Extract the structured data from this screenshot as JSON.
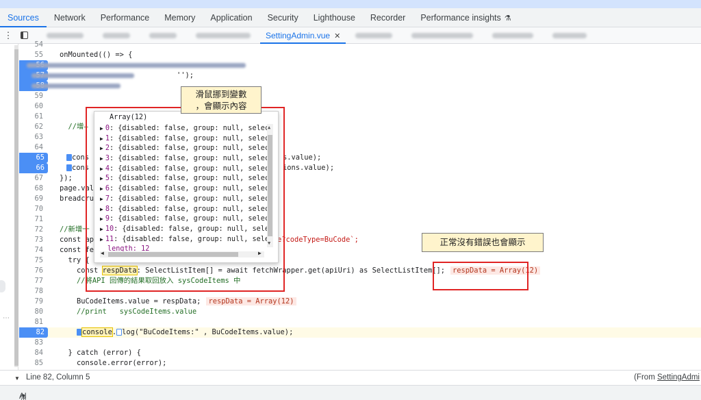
{
  "panel_tabs": [
    {
      "label": "Sources",
      "active": true
    },
    {
      "label": "Network"
    },
    {
      "label": "Performance"
    },
    {
      "label": "Memory"
    },
    {
      "label": "Application"
    },
    {
      "label": "Security"
    },
    {
      "label": "Lighthouse"
    },
    {
      "label": "Recorder"
    },
    {
      "label": "Performance insights",
      "icon": "flask-icon"
    }
  ],
  "file_tabs": {
    "active_label": "SettingAdmin.vue",
    "close_glyph": "✕"
  },
  "code_lines": [
    {
      "num": "54"
    },
    {
      "num": "55",
      "text": "onMounted(() => {"
    },
    {
      "num": "56",
      "bp": true
    },
    {
      "num": "57",
      "bp": true,
      "suffix": "'');"
    },
    {
      "num": "58",
      "bp": true
    },
    {
      "num": "59"
    },
    {
      "num": "60"
    },
    {
      "num": "61"
    },
    {
      "num": "62",
      "text": "  //增—"
    },
    {
      "num": "63"
    },
    {
      "num": "64"
    },
    {
      "num": "65",
      "bp": true,
      "text": "cons",
      "tail": "s.value);"
    },
    {
      "num": "66",
      "bp": true,
      "text": "cons",
      "tail": "ions.value);"
    },
    {
      "num": "67",
      "text": "});"
    },
    {
      "num": "68",
      "text": "page.valu"
    },
    {
      "num": "69",
      "text": "breadcrum"
    },
    {
      "num": "70"
    },
    {
      "num": "71"
    },
    {
      "num": "72",
      "text": "//新增一"
    },
    {
      "num": "73",
      "text": "const api",
      "tail": "e?codeType=BuCode`;"
    },
    {
      "num": "74",
      "text": "const fet"
    },
    {
      "num": "75",
      "text": "  try {"
    },
    {
      "num": "76",
      "text_a": "    const ",
      "text_hl": "respData",
      "text_b": ": SelectListItem[] = await fetchWrapper.get(apiUri) as SelectListItem[];",
      "inline": "respData = Array(12)"
    },
    {
      "num": "77",
      "text": "    //將API 回傳的結果取回放入 sysCodeItems 中"
    },
    {
      "num": "78"
    },
    {
      "num": "79",
      "text": "    BuCodeItems.value = respData;",
      "inline": "respData = Array(12)"
    },
    {
      "num": "80",
      "text": "    //print   sysCodeItems.value"
    },
    {
      "num": "81"
    },
    {
      "num": "82",
      "bp": true,
      "current": true,
      "text_a": "    ",
      "text_hl": "console",
      "text_b": ".",
      "text_c": "log(\"BuCodeItems:\" , BuCodeItems.value);"
    },
    {
      "num": "83"
    },
    {
      "num": "84",
      "text": "  } catch (error) {"
    },
    {
      "num": "85",
      "text": "    console.error(error);"
    }
  ],
  "popover": {
    "title": "Array(12)",
    "items": [
      {
        "idx": "0",
        "text": "{disabled: false, group: null, selec"
      },
      {
        "idx": "1",
        "text": "{disabled: false, group: null, selec"
      },
      {
        "idx": "2",
        "text": "{disabled: false, group: null, selec"
      },
      {
        "idx": "3",
        "text": "{disabled: false, group: null, selec"
      },
      {
        "idx": "4",
        "text": "{disabled: false, group: null, selec"
      },
      {
        "idx": "5",
        "text": "{disabled: false, group: null, selec"
      },
      {
        "idx": "6",
        "text": "{disabled: false, group: null, selec"
      },
      {
        "idx": "7",
        "text": "{disabled: false, group: null, selec"
      },
      {
        "idx": "8",
        "text": "{disabled: false, group: null, selec"
      },
      {
        "idx": "9",
        "text": "{disabled: false, group: null, selec"
      },
      {
        "idx": "10",
        "text": "{disabled: false, group: null, sele"
      },
      {
        "idx": "11",
        "text": "{disabled: false, group: null, sele"
      }
    ],
    "length_label": "length: 12"
  },
  "callouts": {
    "hover": "滑鼠挪到變數\n，會顯示內容",
    "normal": "正常沒有錯誤也會顯示"
  },
  "status": {
    "position": "Line 82, Column 5",
    "from_prefix": "(From ",
    "from_file": "SettingAdmi"
  },
  "bottom": {
    "label": "AI assistance",
    "icon": "flask-icon"
  },
  "colors": {
    "accent": "#1a73e8",
    "breakpoint": "#4b8ff5",
    "annotation_red": "#e02424",
    "callout_bg": "#fff4cc"
  }
}
